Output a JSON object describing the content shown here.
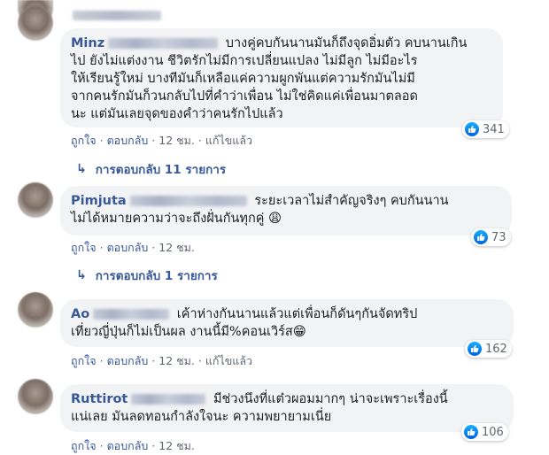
{
  "comments": [
    {
      "name": "Minz",
      "text": "บางคู่คบกันนานมันก็ถึงจุดอิ่มตัว คบนานเกิน\nไป ยังไม่แต่งงาน ชีวิตรักไม่มีการเปลี่ยนแปลง ไม่มีลูก ไม่มีอะไร\nให้เรียนรู้ใหม่ บางทีมันก็เหลือแค่ความผูกพันแต่ความรักมันไม่มี\nจากคนรักมันก็วนกลับไปที่คำว่าเพื่อน ไม่ใช่คิดแค่เพื่อนมาตลอด\nนะ แต่มันเลยจุดของคำว่าคนรักไปแล้ว",
      "like_label": "ถูกใจ",
      "reply_label": "ตอบกลับ",
      "time": "12 ชม.",
      "edited": "แก้ไขแล้ว",
      "reaction_count": "341",
      "replies_label": "การตอบกลับ 11 รายการ"
    },
    {
      "name": "Pimjuta",
      "text": "ระยะเวลาไม่สำคัญจริงๆ คบกันนาน\nไม่ได้หมายความว่าจะถึงฝั่นกันทุกคู่ 😩",
      "like_label": "ถูกใจ",
      "reply_label": "ตอบกลับ",
      "time": "12 ชม.",
      "reaction_count": "73",
      "replies_label": "การตอบกลับ 1 รายการ"
    },
    {
      "name": "Ao",
      "text": "เค้าห่างกันนานแล้วแต่เพื่อนก็ดันๆกันจัดทริป\nเที่ยวญี่ปุ่นก็ไม่เป็นผล งานนี้มี%คอนเวิร์ส😁",
      "like_label": "ถูกใจ",
      "reply_label": "ตอบกลับ",
      "time": "12 ชม.",
      "edited": "แก้ไขแล้ว",
      "reaction_count": "162"
    },
    {
      "name": "Ruttirot",
      "text": "มีช่วงนึงที่แต๋วผอมมากๆ น่าจะเพราะเรื่องนี้\nแน่เลย มันลดทอนกำลังใจนะ ความพยายามเนี่ย",
      "like_label": "ถูกใจ",
      "reply_label": "ตอบกลับ",
      "time": "12 ชม.",
      "reaction_count": "106"
    }
  ],
  "icons": {
    "like": "like-thumb-icon",
    "reply_arrow": "reply-arrow-icon"
  },
  "colors": {
    "name": "#385898",
    "bubble": "#f2f3f5",
    "meta": "#606770",
    "like_blue": "#1877f2"
  }
}
